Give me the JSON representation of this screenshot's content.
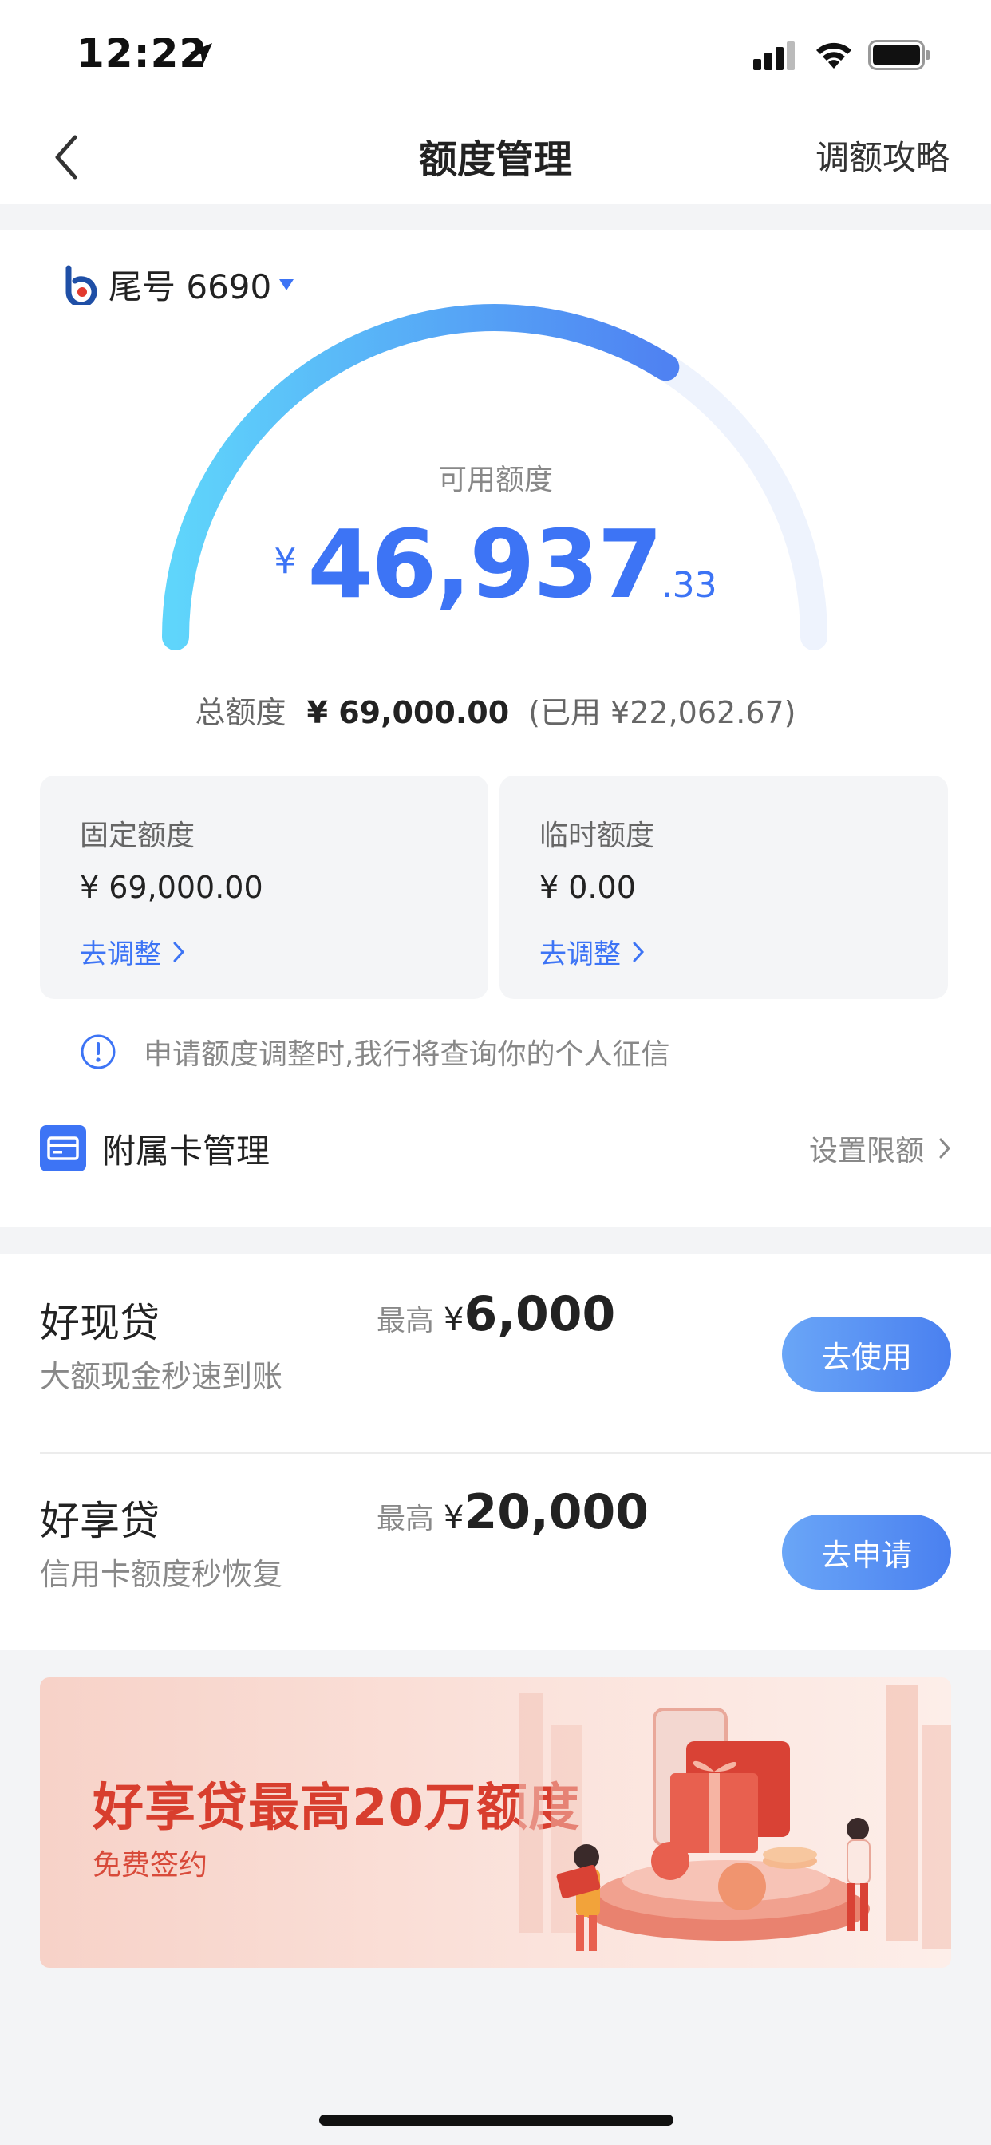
{
  "status_bar": {
    "time": "12:22"
  },
  "nav": {
    "title": "额度管理",
    "right_link": "调额攻略"
  },
  "card": {
    "tail_label": "尾号 6690"
  },
  "credit": {
    "available_label": "可用额度",
    "currency": "¥",
    "available_integer": "46,937",
    "available_decimal": ".33",
    "usage_fraction": 0.68,
    "total_label": "总额度",
    "total_value": "¥ 69,000.00",
    "used_text": "(已用 ¥22,062.67)"
  },
  "quotas": [
    {
      "title": "固定额度",
      "value": "¥ 69,000.00",
      "action": "去调整"
    },
    {
      "title": "临时额度",
      "value": "¥ 0.00",
      "action": "去调整"
    }
  ],
  "notice": "申请额度调整时,我行将查询你的个人征信",
  "supplementary": {
    "title": "附属卡管理",
    "action": "设置限额"
  },
  "loans": [
    {
      "name": "好现贷",
      "desc": "大额现金秒速到账",
      "max_label": "最高",
      "currency": "¥",
      "max_value": "6,000",
      "button": "去使用"
    },
    {
      "name": "好享贷",
      "desc": "信用卡额度秒恢复",
      "max_label": "最高",
      "currency": "¥",
      "max_value": "20,000",
      "button": "去申请"
    }
  ],
  "banner": {
    "title": "好享贷最高20万额度",
    "subtitle": "免费签约"
  },
  "colors": {
    "accent": "#3d74f5",
    "gauge_start": "#5fd5fb",
    "gauge_end": "#4f82f2",
    "banner_text": "#d83e2e"
  }
}
